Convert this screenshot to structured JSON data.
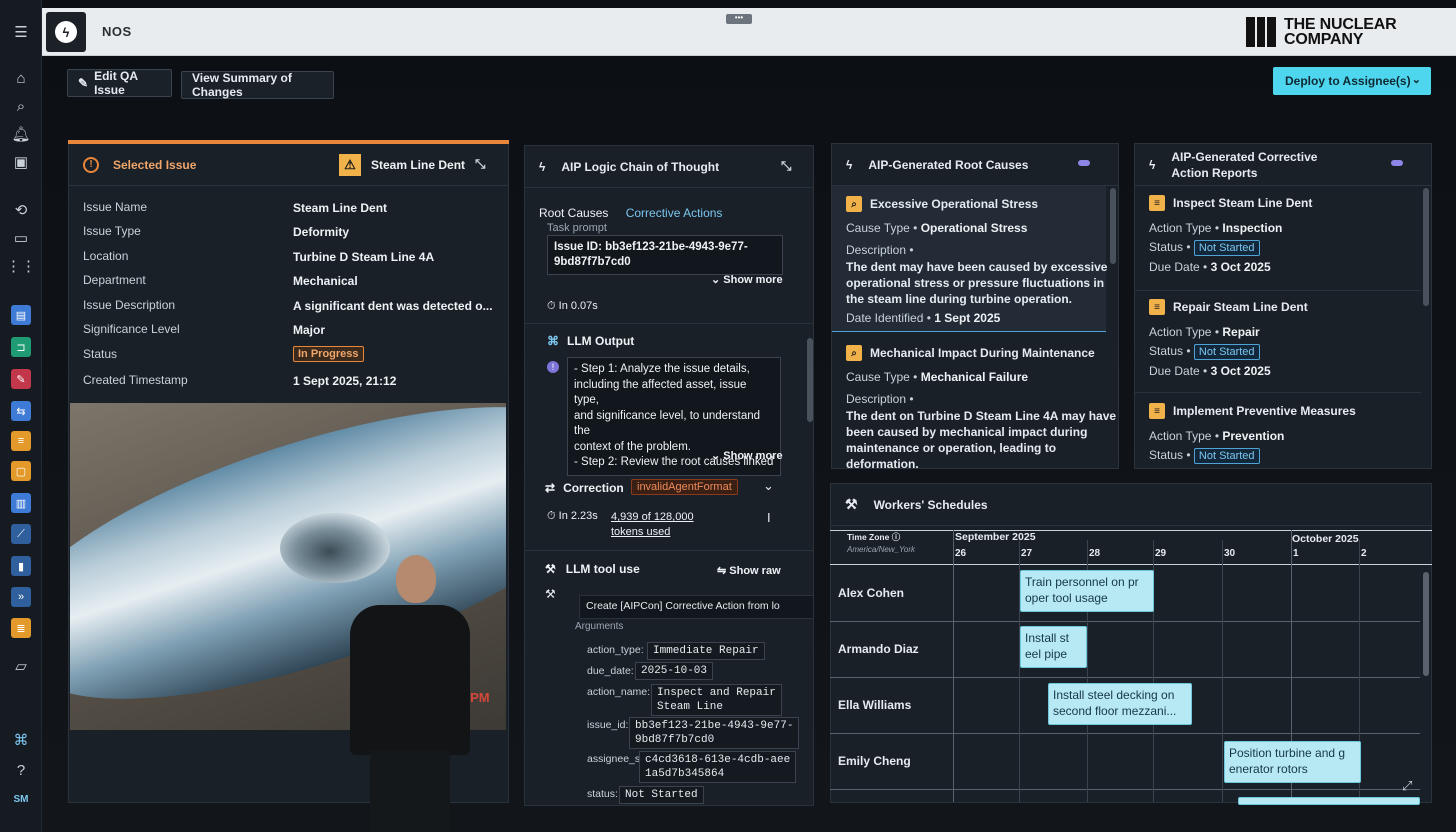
{
  "app": {
    "title": "NOS",
    "company": "THE NUCLEAR COMPANY"
  },
  "rail": {
    "user_initials": "SM"
  },
  "toolbar": {
    "edit": "Edit QA Issue",
    "summary": "View Summary of Changes",
    "deploy": "Deploy to Assignee(s)"
  },
  "issue": {
    "header": "Selected Issue",
    "badge": "Steam Line Dent",
    "labels": [
      "Issue Name",
      "Issue Type",
      "Location",
      "Department",
      "Issue Description",
      "Significance Level",
      "Status",
      "Created Timestamp"
    ],
    "values": [
      "Steam Line Dent",
      "Deformity",
      "Turbine D Steam Line 4A",
      "Mechanical",
      "A significant dent was detected o...",
      "Major",
      "In Progress",
      "1 Sept 2025, 21:12"
    ],
    "photo_stamp": "16 PM"
  },
  "chain": {
    "header": "AIP Logic Chain of Thought",
    "tabs": [
      "Root Causes",
      "Corrective Actions"
    ],
    "task_prompt": "Task prompt",
    "issue_id_line1": "Issue ID: bb3ef123-21be-4943-9e77-",
    "issue_id_line2": "9bd87f7b7cd0",
    "show_more": "Show more",
    "time1": "In 0.07s",
    "llm_output": "LLM Output",
    "output_lines": [
      "- Step 1: Analyze the issue details,",
      "including the affected asset, issue type,",
      "and significance level, to understand the",
      "context of the problem.",
      "- Step 2: Review the root causes linked"
    ],
    "correction": "Correction",
    "correction_tag": "invalidAgentFormat",
    "time2": "In 2.23s",
    "tokens_line1": "4,939 of 128,000",
    "tokens_line2": "tokens used",
    "tool_use": "LLM tool use",
    "show_raw": "Show raw",
    "tool_name": "Create [AIPCon] Corrective Action from lo",
    "arguments": "Arguments",
    "args": [
      {
        "key": "action_type:",
        "value": "Immediate Repair"
      },
      {
        "key": "due_date:",
        "value": "2025-10-03"
      },
      {
        "key": "action_name:",
        "value": "Inspect and Repair\nSteam Line"
      },
      {
        "key": "issue_id:",
        "value": "bb3ef123-21be-4943-9e77-\n9bd87f7b7cd0"
      },
      {
        "key": "assignee_s:",
        "value": "c4cd3618-613e-4cdb-aee\n1a5d7b345864"
      },
      {
        "key": "status:",
        "value": "Not Started"
      }
    ]
  },
  "root_causes": {
    "header": "AIP-Generated Root Causes",
    "items": [
      {
        "title": "Excessive Operational Stress",
        "cause_type_label": "Cause Type •",
        "cause_type": "Operational Stress",
        "desc_label": "Description •",
        "desc": [
          "The dent may have been caused by excessive",
          "operational stress or pressure fluctuations in",
          "the steam line during turbine operation."
        ],
        "date_label": "Date Identified •",
        "date": "1 Sept 2025"
      },
      {
        "title": "Mechanical Impact During Maintenance",
        "cause_type_label": "Cause Type •",
        "cause_type": "Mechanical Failure",
        "desc_label": "Description •",
        "desc": [
          "The dent on Turbine D Steam Line 4A may have",
          "been caused by mechanical impact during",
          "maintenance or operation, leading to",
          "deformation."
        ]
      }
    ]
  },
  "actions": {
    "header_line1": "AIP-Generated Corrective",
    "header_line2": "Action Reports",
    "items": [
      {
        "title": "Inspect Steam Line Dent",
        "type_label": "Action Type •",
        "type": "Inspection",
        "status_label": "Status •",
        "status": "Not Started",
        "due_label": "Due Date •",
        "due": "3 Oct 2025"
      },
      {
        "title": "Repair Steam Line Dent",
        "type_label": "Action Type •",
        "type": "Repair",
        "status_label": "Status •",
        "status": "Not Started",
        "due_label": "Due Date •",
        "due": "3 Oct 2025"
      },
      {
        "title": "Implement Preventive Measures",
        "type_label": "Action Type •",
        "type": "Prevention",
        "status_label": "Status •",
        "status": "Not Started"
      }
    ]
  },
  "schedules": {
    "header": "Workers' Schedules",
    "tz_label": "Time Zone",
    "tz_value": "America/New_York",
    "month1": "September 2025",
    "month2": "October 2025",
    "days": [
      "26",
      "27",
      "28",
      "29",
      "30",
      "1",
      "2"
    ],
    "workers": [
      "Alex Cohen",
      "Armando Diaz",
      "Ella Williams",
      "Emily Cheng"
    ],
    "tasks": [
      "Train personnel on pr oper tool usage",
      "Install st eel pipe",
      "Install steel decking on second floor mezzani...",
      "Position turbine and g enerator rotors"
    ]
  }
}
